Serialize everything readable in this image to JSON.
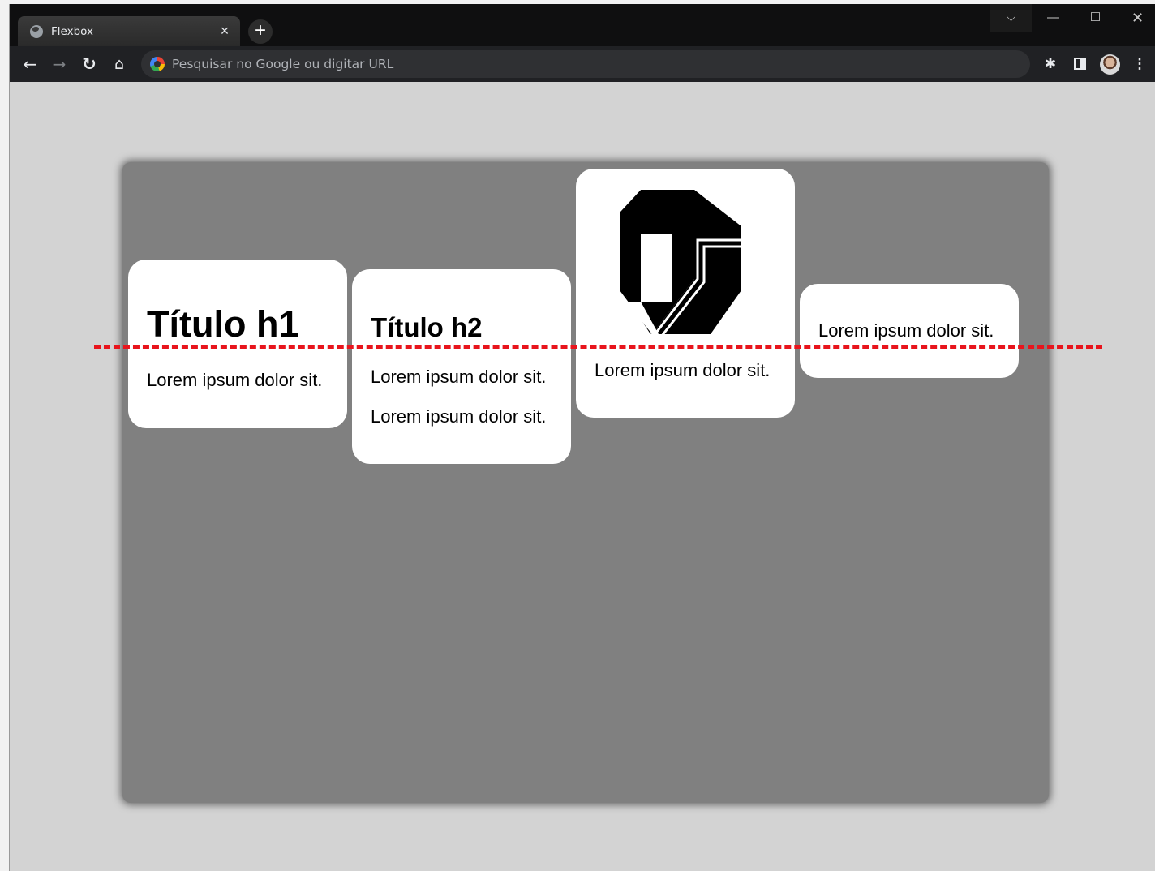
{
  "browser": {
    "tab_title": "Flexbox",
    "tab_close": "×",
    "new_tab": "+",
    "address_placeholder": "Pesquisar no Google ou digitar URL",
    "window_controls": {
      "dropdown": "⌵",
      "minimize": "—",
      "maximize": "☐",
      "close": "✕"
    },
    "nav": {
      "back": "←",
      "forward": "→",
      "reload": "↻",
      "home": "⌂"
    },
    "toolbar": {
      "extensions": "✱",
      "menu": "⋮"
    }
  },
  "page": {
    "cards": [
      {
        "heading": "Título h1",
        "text": "Lorem ipsum dolor sit."
      },
      {
        "heading": "Título h2",
        "text1": "Lorem ipsum dolor sit.",
        "text2": "Lorem ipsum dolor sit."
      },
      {
        "image": "ufu-logo",
        "text": "Lorem ipsum dolor sit."
      },
      {
        "text": "Lorem ipsum dolor sit."
      }
    ],
    "baseline_color": "#e8141c",
    "container_color": "#808080",
    "background_color": "#d3d3d3"
  }
}
